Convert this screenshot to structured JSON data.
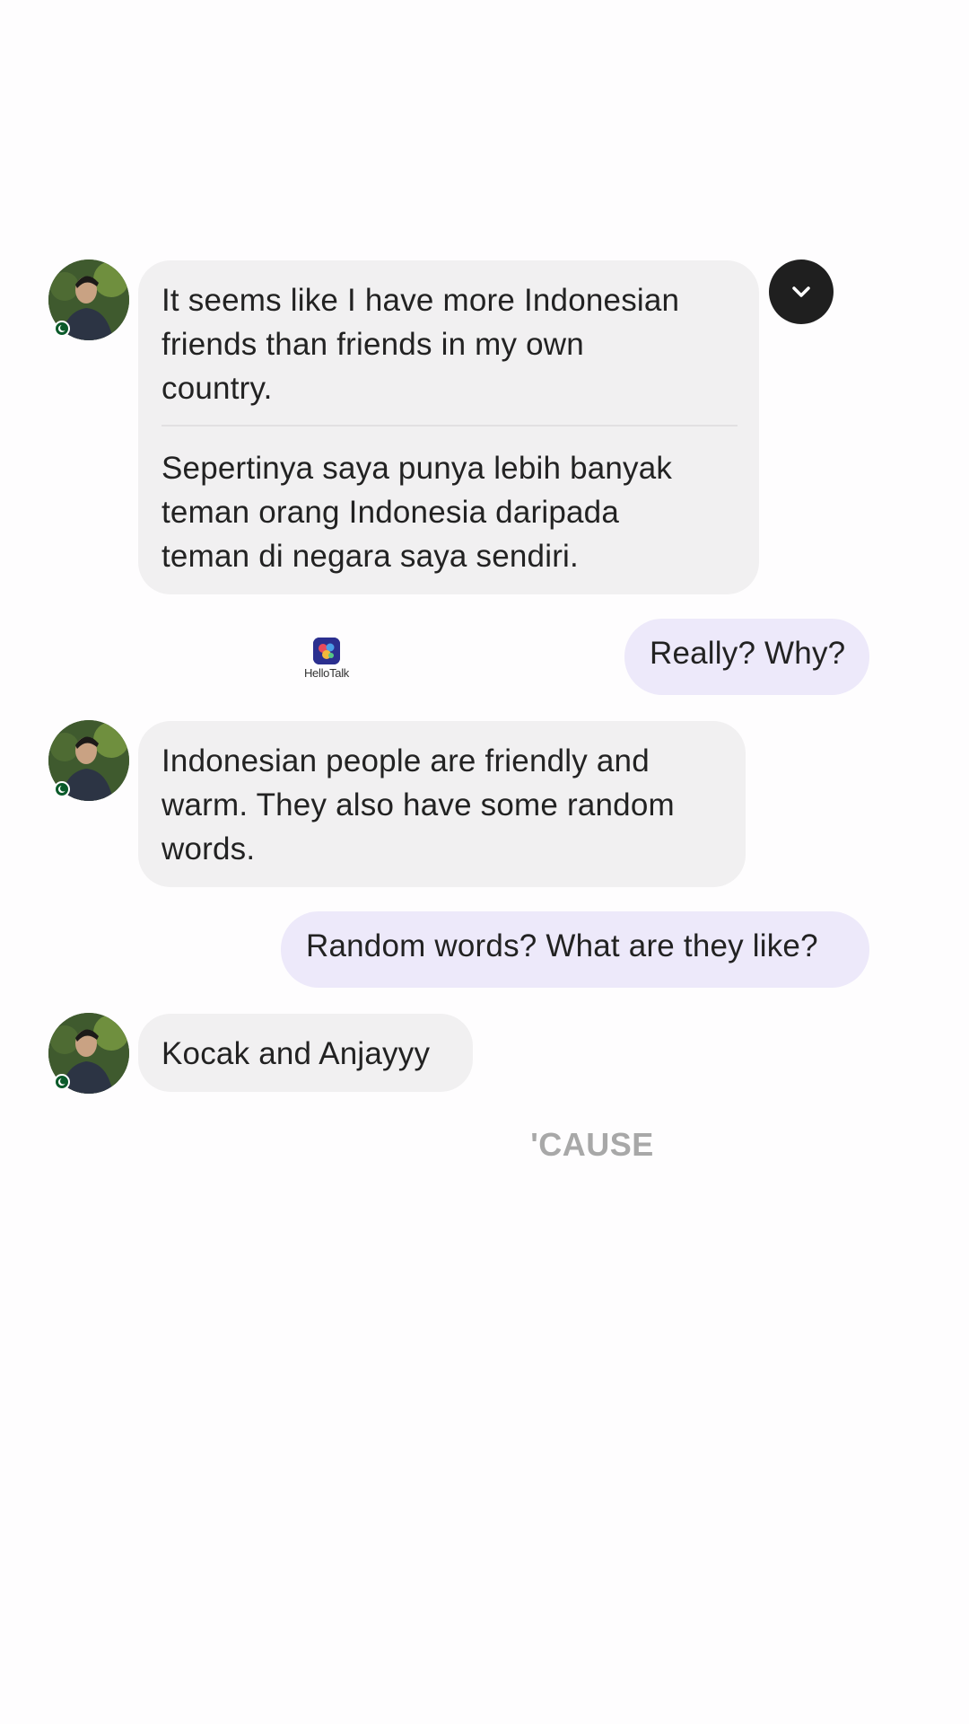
{
  "colors": {
    "background": "#fefdfe",
    "incoming_bubble": "#f1f0f1",
    "outgoing_bubble": "#ede9fa",
    "text": "#222222",
    "scroll_button": "#1f1f1f",
    "caption": "#a8a8a8"
  },
  "messages": [
    {
      "direction": "incoming",
      "original": [
        "It seems like I have more Indonesian",
        "friends than friends in my own",
        "country."
      ],
      "translation": [
        "Sepertinya saya punya lebih banyak",
        "teman orang Indonesia daripada",
        "teman di negara saya sendiri."
      ]
    },
    {
      "direction": "outgoing",
      "text": "Really? Why?"
    },
    {
      "direction": "incoming",
      "original": [
        "Indonesian people are friendly and",
        "warm. They also have some random",
        "words."
      ]
    },
    {
      "direction": "outgoing",
      "text": "Random words? What are they like?"
    },
    {
      "direction": "incoming",
      "original": [
        "Kocak and Anjayyy"
      ]
    }
  ],
  "icons": {
    "scroll_down": "chevron-down-icon",
    "sender_flag": "pakistan-flag-icon",
    "watermark": "hellotalk-logo-icon"
  },
  "watermark": {
    "text": "HelloTalk"
  },
  "caption": {
    "text": "'CAUSE"
  }
}
